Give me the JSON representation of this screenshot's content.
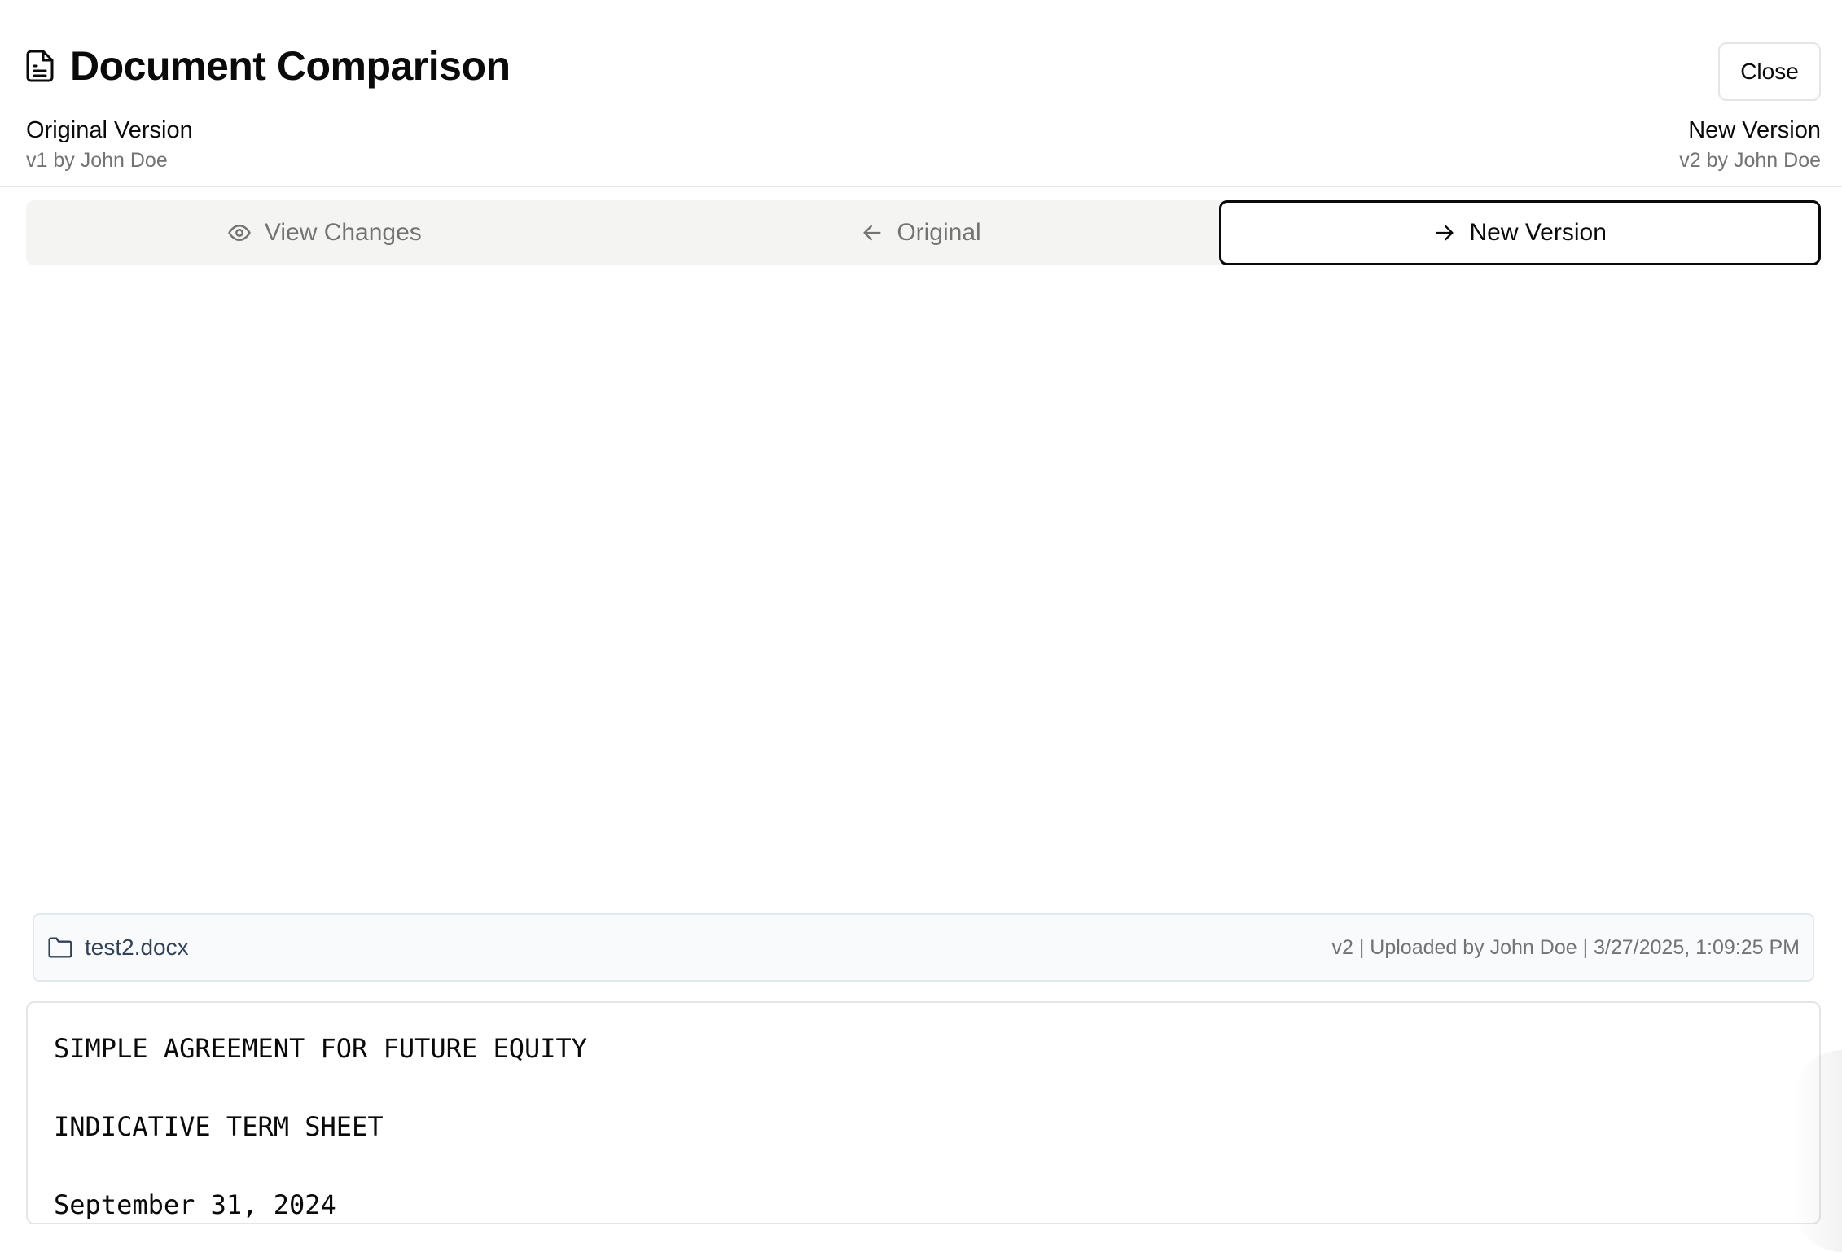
{
  "header": {
    "title": "Document Comparison",
    "icon": "document-icon",
    "close_label": "Close"
  },
  "versions": {
    "original": {
      "label": "Original Version",
      "sub": "v1 by John Doe"
    },
    "new": {
      "label": "New Version",
      "sub": "v2 by John Doe"
    }
  },
  "tabs": [
    {
      "label": "View Changes",
      "icon": "eye-icon",
      "active": false
    },
    {
      "label": "Original",
      "icon": "arrow-left-icon",
      "active": false
    },
    {
      "label": "New Version",
      "icon": "arrow-right-icon",
      "active": true
    }
  ],
  "file": {
    "icon": "folder-icon",
    "name": "test2.docx",
    "meta": "v2 | Uploaded by John Doe | 3/27/2025, 1:09:25 PM"
  },
  "document": {
    "lines": [
      "SIMPLE AGREEMENT FOR FUTURE EQUITY",
      "INDICATIVE TERM SHEET",
      "September 31, 2024"
    ]
  }
}
